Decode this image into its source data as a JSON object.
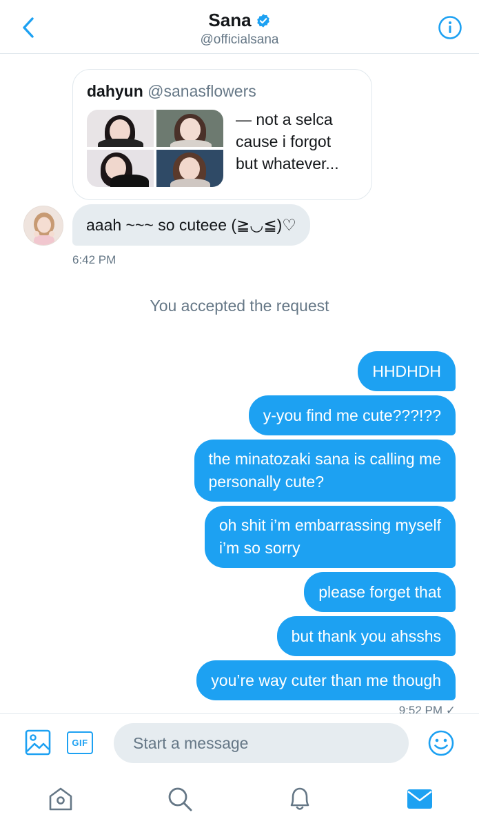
{
  "header": {
    "title": "Sana",
    "handle": "@officialsana"
  },
  "shared_tweet": {
    "author_name": "dahyun",
    "author_handle": "@sanasflowers",
    "text": "—   not a selca\ncause i forgot\nbut whatever..."
  },
  "incoming": {
    "text": "aaah ~~~ so cuteee (≧◡≦)♡",
    "time": "6:42 PM"
  },
  "system_message": "You accepted the request",
  "outgoing": [
    {
      "text": "HHDHDH"
    },
    {
      "text": "y-you find me cute???!??"
    },
    {
      "text": "the minatozaki sana is calling me\npersonally cute?"
    },
    {
      "text": "oh shit i’m embarrassing myself\ni’m so sorry"
    },
    {
      "text": "please forget that"
    },
    {
      "text": "but thank you ahsshs"
    },
    {
      "text": "you’re way cuter than me though"
    }
  ],
  "outgoing_time": "9:52 PM ✓",
  "composer": {
    "gif_label": "GIF",
    "placeholder": "Start a message"
  },
  "colors": {
    "accent": "#1da1f2",
    "incoming_bubble": "#e6ecf0",
    "secondary_text": "#657786",
    "divider": "#e1e8ed"
  },
  "icons": [
    "back-chevron-icon",
    "verified-badge-icon",
    "info-icon",
    "image-icon",
    "gif-icon",
    "emoji-icon",
    "home-icon",
    "search-icon",
    "notifications-bell-icon",
    "messages-envelope-icon"
  ]
}
